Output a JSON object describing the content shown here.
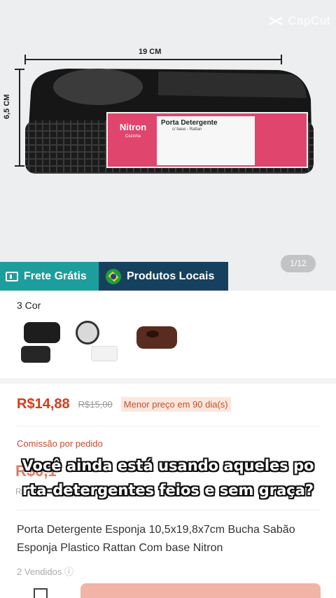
{
  "watermark": {
    "text": "CapCut",
    "icon": "capcut-logo-icon"
  },
  "product_image": {
    "dim_width": "19 CM",
    "dim_height": "6,5 CM",
    "brand": "Nitron",
    "brand_sub": "Cozinha",
    "label_title": "Porta Detergente",
    "label_subtitle": "c/ base - Rattan",
    "counter": "1/12"
  },
  "badges": [
    {
      "label": "Frete Grátis",
      "icon": "truck-icon",
      "color": "#1d9e9c"
    },
    {
      "label": "Produtos Locais",
      "icon": "brazil-flag-icon",
      "color": "#16415e"
    }
  ],
  "variants": {
    "label": "3 Cor",
    "items": [
      "preto",
      "branco",
      "marrom"
    ]
  },
  "price": {
    "current": "R$14,88",
    "original": "R$15,00",
    "badge": "Menor preço em 90 dia(s)",
    "color": "#d43c1a"
  },
  "commission": {
    "label": "Comissão por pedido",
    "value": "R$0,1",
    "sub": "R$ 1"
  },
  "caption": {
    "line1": "Você ainda está usando aqueles po",
    "line2": "rta-detergentes feios e sem graça?"
  },
  "title": "Porta Detergente Esponja 10,5x19,8x7cm Bucha Sabão Esponja Plastico Rattan Com base Nitron",
  "sold": "2 Vendidos ⓘ"
}
